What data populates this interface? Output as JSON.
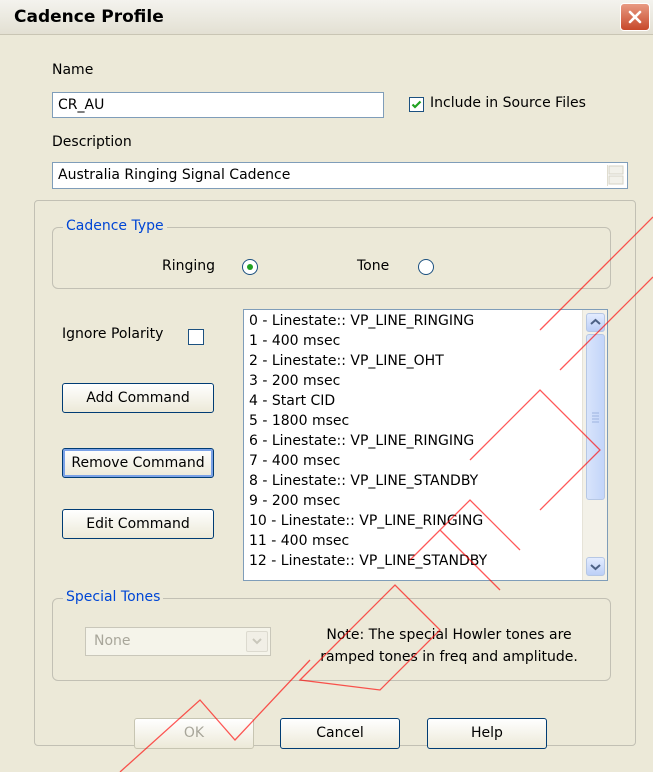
{
  "window": {
    "title": "Cadence Profile"
  },
  "name_field": {
    "label": "Name",
    "value": "CR_AU"
  },
  "include_source": {
    "label": "Include in Source Files",
    "checked": true
  },
  "description_field": {
    "label": "Description",
    "value": "Australia Ringing Signal Cadence"
  },
  "cadence_type": {
    "caption": "Cadence Type",
    "ringing_label": "Ringing",
    "tone_label": "Tone",
    "selected": "Ringing"
  },
  "ignore_polarity": {
    "label": "Ignore Polarity",
    "checked": false
  },
  "buttons": {
    "add_command": "Add Command",
    "remove_command": "Remove Command",
    "edit_command": "Edit Command",
    "ok": "OK",
    "cancel": "Cancel",
    "help": "Help"
  },
  "commands": [
    "0 - Linestate:: VP_LINE_RINGING",
    "1 - 400 msec",
    "2 - Linestate:: VP_LINE_OHT",
    "3 - 200 msec",
    "4 - Start CID",
    "5 - 1800 msec",
    "6 - Linestate:: VP_LINE_RINGING",
    "7 - 400 msec",
    "8 - Linestate:: VP_LINE_STANDBY",
    "9 - 200 msec",
    "10 - Linestate:: VP_LINE_RINGING",
    "11 - 400 msec",
    "12 - Linestate:: VP_LINE_STANDBY"
  ],
  "special_tones": {
    "caption": "Special Tones",
    "selected": "None",
    "note_line1": "Note: The special Howler tones are",
    "note_line2": "ramped tones in freq and amplitude."
  },
  "colors": {
    "group_caption": "#0046d5",
    "watermark": "#ff0000",
    "dialog_bg": "#ece9d8"
  }
}
